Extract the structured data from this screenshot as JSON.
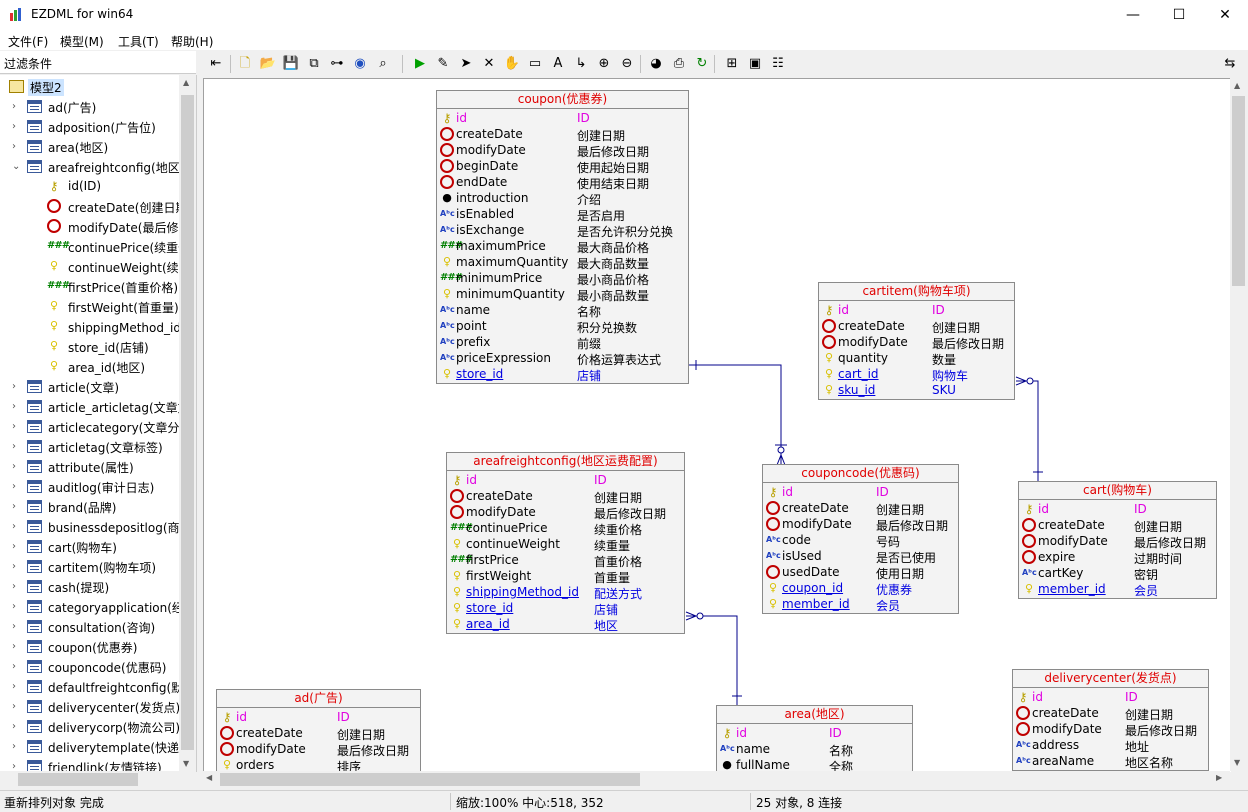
{
  "window": {
    "title": "EZDML for win64",
    "controls": [
      "minimize-icon",
      "maximize-icon",
      "close-icon"
    ]
  },
  "menu": [
    "文件(F)",
    "模型(M)",
    "工具(T)",
    "帮助(H)"
  ],
  "filter_label": "过滤条件",
  "tree": {
    "root": "模型2",
    "items": [
      {
        "label": "ad(广告)",
        "level": 1,
        "expander": "collapsed",
        "icon": "table-icon"
      },
      {
        "label": "adposition(广告位)",
        "level": 1,
        "expander": "collapsed",
        "icon": "table-icon"
      },
      {
        "label": "area(地区)",
        "level": 1,
        "expander": "collapsed",
        "icon": "table-icon"
      },
      {
        "label": "areafreightconfig(地区运费配置)",
        "level": 1,
        "expander": "expanded",
        "icon": "table-icon"
      },
      {
        "label": "id(ID)",
        "level": 2,
        "icon": "key-icon"
      },
      {
        "label": "createDate(创建日期)",
        "level": 2,
        "icon": "clock-icon"
      },
      {
        "label": "modifyDate(最后修改日期)",
        "level": 2,
        "icon": "clock-icon"
      },
      {
        "label": "continuePrice(续重价格)",
        "level": 2,
        "icon": "number-icon"
      },
      {
        "label": "continueWeight(续重量)",
        "level": 2,
        "icon": "bulb-icon"
      },
      {
        "label": "firstPrice(首重价格)",
        "level": 2,
        "icon": "number-icon"
      },
      {
        "label": "firstWeight(首重量)",
        "level": 2,
        "icon": "bulb-icon"
      },
      {
        "label": "shippingMethod_id(配送方式)",
        "level": 2,
        "icon": "bulb-icon"
      },
      {
        "label": "store_id(店铺)",
        "level": 2,
        "icon": "bulb-icon"
      },
      {
        "label": "area_id(地区)",
        "level": 2,
        "icon": "bulb-icon"
      },
      {
        "label": "article(文章)",
        "level": 1,
        "expander": "collapsed",
        "icon": "table-icon"
      },
      {
        "label": "article_articletag(文章文章标签)",
        "level": 1,
        "expander": "collapsed",
        "icon": "table-icon"
      },
      {
        "label": "articlecategory(文章分类)",
        "level": 1,
        "expander": "collapsed",
        "icon": "table-icon"
      },
      {
        "label": "articletag(文章标签)",
        "level": 1,
        "expander": "collapsed",
        "icon": "table-icon"
      },
      {
        "label": "attribute(属性)",
        "level": 1,
        "expander": "collapsed",
        "icon": "table-icon"
      },
      {
        "label": "auditlog(审计日志)",
        "level": 1,
        "expander": "collapsed",
        "icon": "table-icon"
      },
      {
        "label": "brand(品牌)",
        "level": 1,
        "expander": "collapsed",
        "icon": "table-icon"
      },
      {
        "label": "businessdepositlog(商家预存款)",
        "level": 1,
        "expander": "collapsed",
        "icon": "table-icon"
      },
      {
        "label": "cart(购物车)",
        "level": 1,
        "expander": "collapsed",
        "icon": "table-icon"
      },
      {
        "label": "cartitem(购物车项)",
        "level": 1,
        "expander": "collapsed",
        "icon": "table-icon"
      },
      {
        "label": "cash(提现)",
        "level": 1,
        "expander": "collapsed",
        "icon": "table-icon"
      },
      {
        "label": "categoryapplication(经营分类申请)",
        "level": 1,
        "expander": "collapsed",
        "icon": "table-icon"
      },
      {
        "label": "consultation(咨询)",
        "level": 1,
        "expander": "collapsed",
        "icon": "table-icon"
      },
      {
        "label": "coupon(优惠券)",
        "level": 1,
        "expander": "collapsed",
        "icon": "table-icon"
      },
      {
        "label": "couponcode(优惠码)",
        "level": 1,
        "expander": "collapsed",
        "icon": "table-icon"
      },
      {
        "label": "defaultfreightconfig(默认运费配置)",
        "level": 1,
        "expander": "collapsed",
        "icon": "table-icon"
      },
      {
        "label": "deliverycenter(发货点)",
        "level": 1,
        "expander": "collapsed",
        "icon": "table-icon"
      },
      {
        "label": "deliverycorp(物流公司)",
        "level": 1,
        "expander": "collapsed",
        "icon": "table-icon"
      },
      {
        "label": "deliverytemplate(快递单模板)",
        "level": 1,
        "expander": "collapsed",
        "icon": "table-icon"
      },
      {
        "label": "friendlink(友情链接)",
        "level": 1,
        "expander": "collapsed",
        "icon": "table-icon"
      }
    ]
  },
  "toolbar": {
    "icons": [
      "panel-toggle-icon",
      "new-icon",
      "open-icon",
      "save-icon",
      "copy-icon",
      "tree-icon",
      "globe-icon",
      "find-icon",
      "run-icon",
      "pen-icon",
      "pointer-icon",
      "delete-icon",
      "hand-icon",
      "rect-icon",
      "text-icon",
      "link-icon",
      "zoom-in-icon",
      "zoom-out-icon",
      "eye-icon",
      "print-icon",
      "refresh-icon",
      "layout-icon",
      "image-icon",
      "properties-icon",
      "window-toggle-icon"
    ],
    "glyphs": {
      "panel-toggle-icon": "⇤",
      "new-icon": "🗋",
      "open-icon": "📂",
      "save-icon": "💾",
      "copy-icon": "⧉",
      "tree-icon": "⊶",
      "globe-icon": "◉",
      "find-icon": "⌕",
      "run-icon": "▶",
      "pen-icon": "✎",
      "pointer-icon": "➤",
      "delete-icon": "✕",
      "hand-icon": "✋",
      "rect-icon": "▭",
      "text-icon": "A",
      "link-icon": "↳",
      "zoom-in-icon": "⊕",
      "zoom-out-icon": "⊖",
      "eye-icon": "◕",
      "print-icon": "⎙",
      "refresh-icon": "↻",
      "layout-icon": "⊞",
      "image-icon": "▣",
      "properties-icon": "☷",
      "window-toggle-icon": "⇆"
    }
  },
  "entities": [
    {
      "name": "coupon(优惠券)",
      "fields": [
        {
          "icon": "key",
          "name": "id",
          "comment": "ID",
          "kind": "pk"
        },
        {
          "icon": "clock",
          "name": "createDate",
          "comment": "创建日期"
        },
        {
          "icon": "clock",
          "name": "modifyDate",
          "comment": "最后修改日期"
        },
        {
          "icon": "clock",
          "name": "beginDate",
          "comment": "使用起始日期"
        },
        {
          "icon": "clock",
          "name": "endDate",
          "comment": "使用结束日期"
        },
        {
          "icon": "dot",
          "name": "introduction",
          "comment": "介绍"
        },
        {
          "icon": "abc",
          "name": "isEnabled",
          "comment": "是否启用"
        },
        {
          "icon": "abc",
          "name": "isExchange",
          "comment": "是否允许积分兑换"
        },
        {
          "icon": "num",
          "name": "maximumPrice",
          "comment": "最大商品价格"
        },
        {
          "icon": "bulb",
          "name": "maximumQuantity",
          "comment": "最大商品数量"
        },
        {
          "icon": "num",
          "name": "minimumPrice",
          "comment": "最小商品价格"
        },
        {
          "icon": "bulb",
          "name": "minimumQuantity",
          "comment": "最小商品数量"
        },
        {
          "icon": "abc",
          "name": "name",
          "comment": "名称"
        },
        {
          "icon": "abc",
          "name": "point",
          "comment": "积分兑换数"
        },
        {
          "icon": "abc",
          "name": "prefix",
          "comment": "前缀"
        },
        {
          "icon": "abc",
          "name": "priceExpression",
          "comment": "价格运算表达式"
        },
        {
          "icon": "bulb",
          "name": "store_id",
          "comment": "店铺",
          "kind": "fk"
        }
      ]
    },
    {
      "name": "cartitem(购物车项)",
      "fields": [
        {
          "icon": "key",
          "name": "id",
          "comment": "ID",
          "kind": "pk"
        },
        {
          "icon": "clock",
          "name": "createDate",
          "comment": "创建日期"
        },
        {
          "icon": "clock",
          "name": "modifyDate",
          "comment": "最后修改日期"
        },
        {
          "icon": "bulb",
          "name": "quantity",
          "comment": "数量"
        },
        {
          "icon": "bulb",
          "name": "cart_id",
          "comment": "购物车",
          "kind": "fk"
        },
        {
          "icon": "bulb",
          "name": "sku_id",
          "comment": "SKU",
          "kind": "fk"
        }
      ]
    },
    {
      "name": "areafreightconfig(地区运费配置)",
      "fields": [
        {
          "icon": "key",
          "name": "id",
          "comment": "ID",
          "kind": "pk"
        },
        {
          "icon": "clock",
          "name": "createDate",
          "comment": "创建日期"
        },
        {
          "icon": "clock",
          "name": "modifyDate",
          "comment": "最后修改日期"
        },
        {
          "icon": "num",
          "name": "continuePrice",
          "comment": "续重价格"
        },
        {
          "icon": "bulb",
          "name": "continueWeight",
          "comment": "续重量"
        },
        {
          "icon": "num",
          "name": "firstPrice",
          "comment": "首重价格"
        },
        {
          "icon": "bulb",
          "name": "firstWeight",
          "comment": "首重量"
        },
        {
          "icon": "bulb",
          "name": "shippingMethod_id",
          "comment": "配送方式",
          "kind": "fk"
        },
        {
          "icon": "bulb",
          "name": "store_id",
          "comment": "店铺",
          "kind": "fk"
        },
        {
          "icon": "bulb",
          "name": "area_id",
          "comment": "地区",
          "kind": "fk"
        }
      ]
    },
    {
      "name": "couponcode(优惠码)",
      "fields": [
        {
          "icon": "key",
          "name": "id",
          "comment": "ID",
          "kind": "pk"
        },
        {
          "icon": "clock",
          "name": "createDate",
          "comment": "创建日期"
        },
        {
          "icon": "clock",
          "name": "modifyDate",
          "comment": "最后修改日期"
        },
        {
          "icon": "abc",
          "name": "code",
          "comment": "号码"
        },
        {
          "icon": "abc",
          "name": "isUsed",
          "comment": "是否已使用"
        },
        {
          "icon": "clock",
          "name": "usedDate",
          "comment": "使用日期"
        },
        {
          "icon": "bulb",
          "name": "coupon_id",
          "comment": "优惠券",
          "kind": "fk"
        },
        {
          "icon": "bulb",
          "name": "member_id",
          "comment": "会员",
          "kind": "fk"
        }
      ]
    },
    {
      "name": "cart(购物车)",
      "fields": [
        {
          "icon": "key",
          "name": "id",
          "comment": "ID",
          "kind": "pk"
        },
        {
          "icon": "clock",
          "name": "createDate",
          "comment": "创建日期"
        },
        {
          "icon": "clock",
          "name": "modifyDate",
          "comment": "最后修改日期"
        },
        {
          "icon": "clock",
          "name": "expire",
          "comment": "过期时间"
        },
        {
          "icon": "abc",
          "name": "cartKey",
          "comment": "密钥"
        },
        {
          "icon": "bulb",
          "name": "member_id",
          "comment": "会员",
          "kind": "fk"
        }
      ]
    },
    {
      "name": "ad(广告)",
      "fields": [
        {
          "icon": "key",
          "name": "id",
          "comment": "ID",
          "kind": "pk"
        },
        {
          "icon": "clock",
          "name": "createDate",
          "comment": "创建日期"
        },
        {
          "icon": "clock",
          "name": "modifyDate",
          "comment": "最后修改日期"
        },
        {
          "icon": "bulb",
          "name": "orders",
          "comment": "排序"
        }
      ]
    },
    {
      "name": "area(地区)",
      "fields": [
        {
          "icon": "key",
          "name": "id",
          "comment": "ID",
          "kind": "pk"
        },
        {
          "icon": "abc",
          "name": "name",
          "comment": "名称"
        },
        {
          "icon": "dot",
          "name": "fullName",
          "comment": "全称"
        }
      ]
    },
    {
      "name": "deliverycenter(发货点)",
      "fields": [
        {
          "icon": "key",
          "name": "id",
          "comment": "ID",
          "kind": "pk"
        },
        {
          "icon": "clock",
          "name": "createDate",
          "comment": "创建日期"
        },
        {
          "icon": "clock",
          "name": "modifyDate",
          "comment": "最后修改日期"
        },
        {
          "icon": "abc",
          "name": "address",
          "comment": "地址"
        },
        {
          "icon": "abc",
          "name": "areaName",
          "comment": "地区名称"
        }
      ]
    }
  ],
  "status": {
    "message": "重新排列对象 完成",
    "zoom": "缩放:100% 中心:518, 352",
    "counts": "25 对象, 8 连接"
  },
  "colors": {
    "entity_title": "#e00000",
    "primary_key": "#e000e0",
    "foreign_key": "#0000e0",
    "relation_line": "#00008b"
  }
}
